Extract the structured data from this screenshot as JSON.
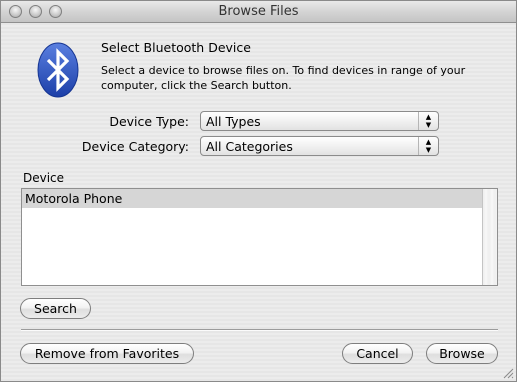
{
  "window": {
    "title": "Browse Files"
  },
  "header": {
    "heading": "Select Bluetooth Device",
    "description": "Select a device to browse files on.  To find devices in range of your computer, click the Search button."
  },
  "filters": {
    "device_type_label": "Device Type:",
    "device_type_value": "All Types",
    "device_category_label": "Device Category:",
    "device_category_value": "All Categories"
  },
  "device_list": {
    "header": "Device",
    "items": [
      "Motorola Phone"
    ],
    "selected_index": 0
  },
  "buttons": {
    "search": "Search",
    "remove_favorites": "Remove from Favorites",
    "cancel": "Cancel",
    "browse": "Browse"
  },
  "colors": {
    "bluetooth_blue": "#2f56c4",
    "selection_gray": "#d6d6d6"
  }
}
